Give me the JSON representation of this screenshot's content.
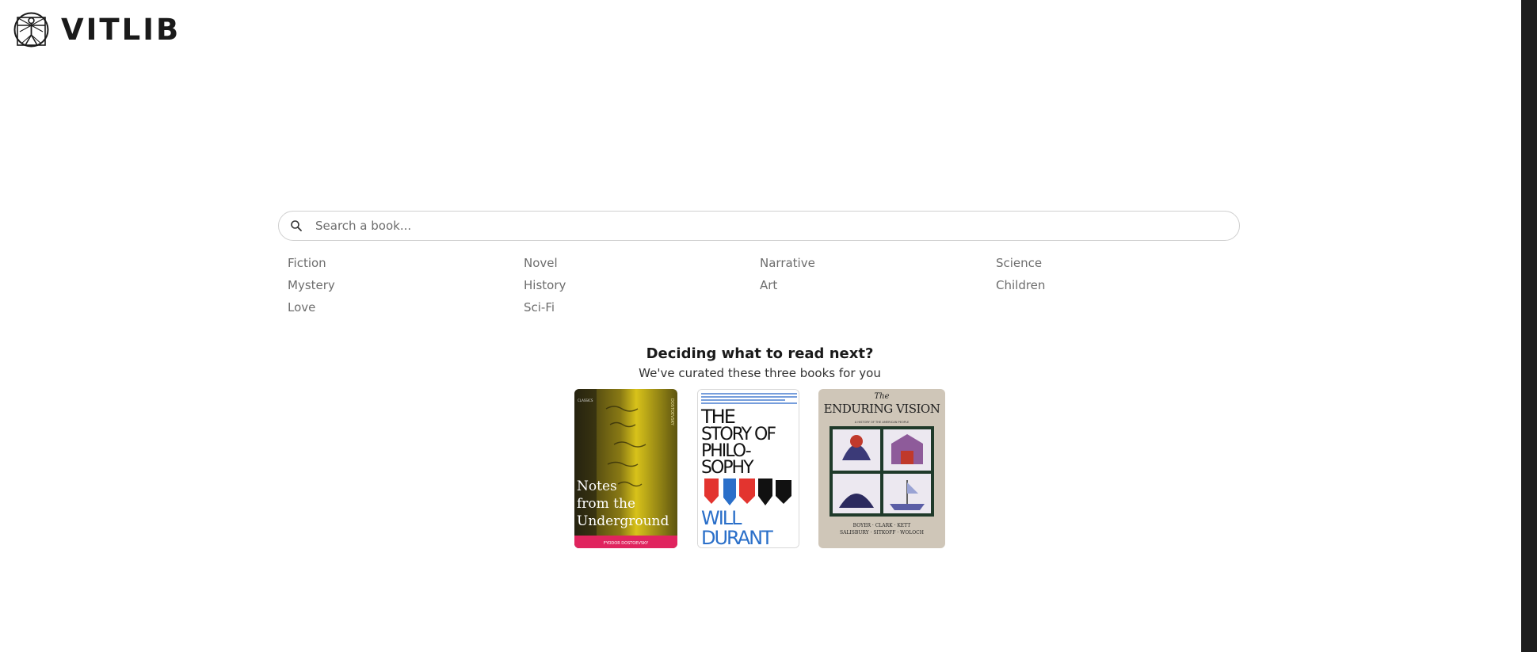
{
  "brand": {
    "name": "VITLIB",
    "logo_icon": "vitruvian-man-icon"
  },
  "search": {
    "placeholder": "Search a book...",
    "value": "",
    "icon": "search-icon"
  },
  "categories": [
    "Fiction",
    "Novel",
    "Narrative",
    "Science",
    "Mystery",
    "History",
    "Art",
    "Children",
    "Love",
    "Sci-Fi"
  ],
  "recommendations": {
    "title": "Deciding what to read next?",
    "subtitle": "We've curated these three books for you",
    "books": [
      {
        "title_lines": [
          "Notes",
          "from the",
          "Underground"
        ],
        "author": "FYODOR DOSTOEVSKY",
        "spine_text": "DOSTOEVSKY"
      },
      {
        "title_lines": [
          "THE",
          "STORY OF",
          "PHILO-",
          "SOPHY"
        ],
        "author_lines": [
          "WILL",
          "DURANT"
        ]
      },
      {
        "title_small": "The",
        "title_lines": [
          "ENDURING VISION"
        ],
        "tagline": "A HISTORY OF THE AMERICAN PEOPLE",
        "authors_line1": "BOYER · CLARK · KETT",
        "authors_line2": "SALISBURY · SITKOFF · WOLOCH"
      }
    ]
  },
  "colors": {
    "scrollbar": "#1e1e1e",
    "category_text": "#6d6d6d",
    "pink_band": "#e0245e",
    "durant_blue": "#2a6fc9"
  }
}
